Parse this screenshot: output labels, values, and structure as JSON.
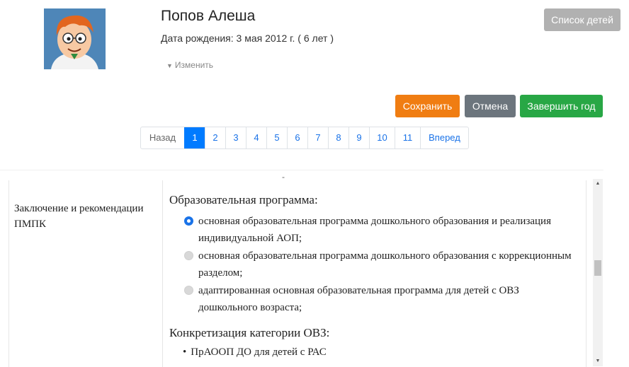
{
  "header": {
    "child_name": "Попов Алеша",
    "birth_line": "Дата рождения: 3 мая 2012 г. ( 6 лет )",
    "edit_label": "Изменить",
    "children_list_label": "Список детей"
  },
  "actions": {
    "save_label": "Сохранить",
    "cancel_label": "Отмена",
    "finish_label": "Завершить год"
  },
  "pagination": {
    "prev_label": "Назад",
    "next_label": "Вперед",
    "pages": [
      "1",
      "2",
      "3",
      "4",
      "5",
      "6",
      "7",
      "8",
      "9",
      "10",
      "11"
    ],
    "current": "1"
  },
  "form": {
    "row_label": "Заключение и рекомендации ПМПК",
    "program_title": "Образовательная программа:",
    "program_options": [
      "основная образовательная программа дошкольного образования и реализация индивидуальной АОП;",
      "основная образовательная программа дошкольного образования с коррекционным разделом;",
      "адаптированная основная образовательная программа для детей с ОВЗ дошкольного возраста;"
    ],
    "selected_option": 0,
    "ovz_title": "Конкретизация категории ОВЗ:",
    "ovz_items": [
      "ПрАООП ДО для детей с РАС"
    ]
  },
  "colors": {
    "save": "#f07d12",
    "cancel": "#6c757d",
    "finish": "#28a745",
    "children_list": "#b1b1b1",
    "active_page": "#007bff",
    "link": "#1a73e8"
  },
  "icons": {
    "avatar": "cartoon-boy-avatar",
    "edit_caret": "caret-down-icon"
  }
}
